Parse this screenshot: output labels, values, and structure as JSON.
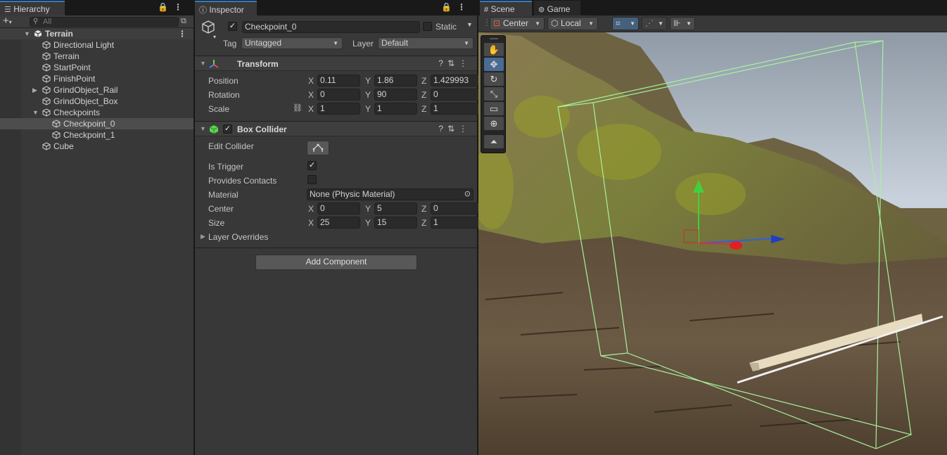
{
  "hierarchy": {
    "tab_label": "Hierarchy",
    "search_placeholder": "All",
    "items": [
      {
        "label": "Terrain",
        "depth": 0,
        "expanded": true,
        "root": true
      },
      {
        "label": "Directional Light",
        "depth": 1
      },
      {
        "label": "Terrain",
        "depth": 1
      },
      {
        "label": "StartPoint",
        "depth": 1
      },
      {
        "label": "FinishPoint",
        "depth": 1
      },
      {
        "label": "GrindObject_Rail",
        "depth": 1,
        "collapsed": true
      },
      {
        "label": "GrindObject_Box",
        "depth": 1
      },
      {
        "label": "Checkpoints",
        "depth": 1,
        "expanded": true
      },
      {
        "label": "Checkpoint_0",
        "depth": 2,
        "selected": true
      },
      {
        "label": "Checkpoint_1",
        "depth": 2
      },
      {
        "label": "Cube",
        "depth": 1
      }
    ]
  },
  "inspector": {
    "tab_label": "Inspector",
    "object_name": "Checkpoint_0",
    "static_label": "Static",
    "tag_label": "Tag",
    "tag_value": "Untagged",
    "layer_label": "Layer",
    "layer_value": "Default",
    "transform": {
      "title": "Transform",
      "position_label": "Position",
      "rotation_label": "Rotation",
      "scale_label": "Scale",
      "position": {
        "x": "0.11",
        "y": "1.86",
        "z": "1.429993"
      },
      "rotation": {
        "x": "0",
        "y": "90",
        "z": "0"
      },
      "scale": {
        "x": "1",
        "y": "1",
        "z": "1"
      }
    },
    "axis": {
      "x": "X",
      "y": "Y",
      "z": "Z"
    },
    "box_collider": {
      "title": "Box Collider",
      "edit_collider_label": "Edit Collider",
      "is_trigger_label": "Is Trigger",
      "is_trigger": true,
      "provides_contacts_label": "Provides Contacts",
      "provides_contacts": false,
      "material_label": "Material",
      "material_value": "None (Physic Material)",
      "center_label": "Center",
      "size_label": "Size",
      "center": {
        "x": "0",
        "y": "5",
        "z": "0"
      },
      "size": {
        "x": "25",
        "y": "15",
        "z": "1"
      },
      "layer_overrides_label": "Layer Overrides"
    },
    "add_component_label": "Add Component"
  },
  "scene": {
    "tabs": [
      "Scene",
      "Game"
    ],
    "pivot_mode": "Center",
    "pivot_rotation": "Local",
    "tools": [
      "hand",
      "move",
      "rotate",
      "scale",
      "rect",
      "transform",
      "custom"
    ],
    "active_tool": "move"
  },
  "colors": {
    "accent": "#3a79bb",
    "panel": "#383838",
    "collider_line": "#a8f0a0",
    "axis_x": "#e03030",
    "axis_y": "#40d040",
    "axis_z": "#3060e0"
  }
}
